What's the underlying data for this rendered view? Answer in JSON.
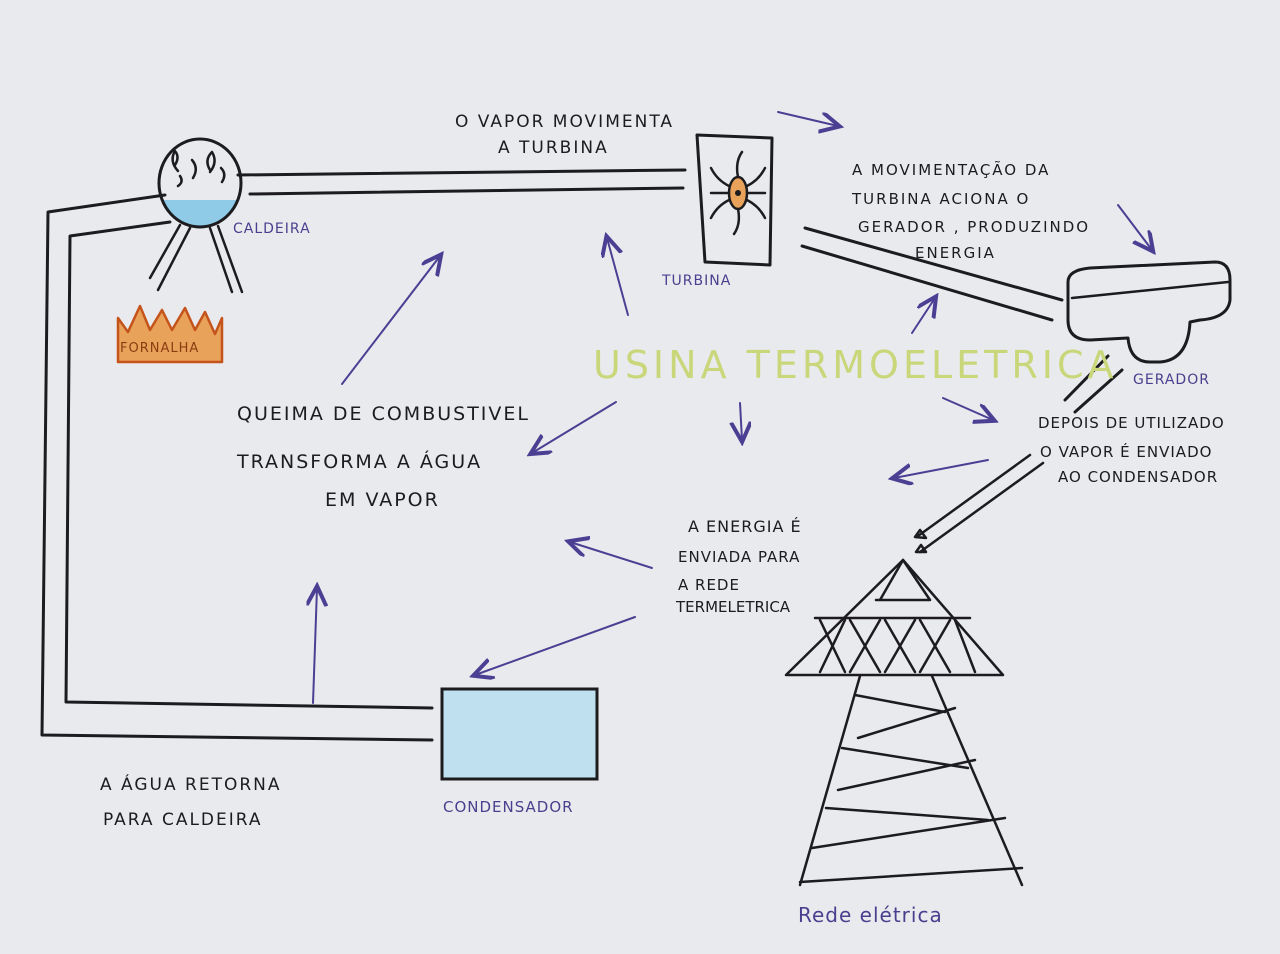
{
  "title": "USINA TERMOELETRICA",
  "labels": {
    "caldeira": "CALDEIRA",
    "fornalha": "FORNALHA",
    "turbina": "TURBINA",
    "gerador": "GERADOR",
    "condensador": "CONDENSADOR",
    "rede_eletrica": "Rede elétrica"
  },
  "notes": {
    "vapor_turbina": [
      "O VAPOR MOVIMENTA",
      "A TURBINA"
    ],
    "movimentacao": [
      "A MOVIMENTAÇÃO DA",
      "TURBINA ACIONA O",
      "GERADOR , PRODUZINDO",
      "ENERGIA"
    ],
    "queima": [
      "QUEIMA DE COMBUSTIVEL",
      "TRANSFORMA A ÁGUA",
      "EM VAPOR"
    ],
    "depois": [
      "DEPOIS DE UTILIZADO",
      "O VAPOR É ENVIADO",
      "AO CONDENSADOR"
    ],
    "energia": [
      "A ENERGIA É",
      "ENVIADA PARA",
      "A REDE",
      "TERMELETRICA"
    ],
    "agua_retorna": [
      "A ÁGUA RETORNA",
      "PARA CALDEIRA"
    ]
  },
  "colors": {
    "ink": "#1c1c1f",
    "label": "#4a3f8e",
    "arrow": "#4b3f93",
    "water": "#8fcbe6",
    "flame": "#e9a25a",
    "title": "#c9d77a",
    "paper": "#e9eaee"
  }
}
